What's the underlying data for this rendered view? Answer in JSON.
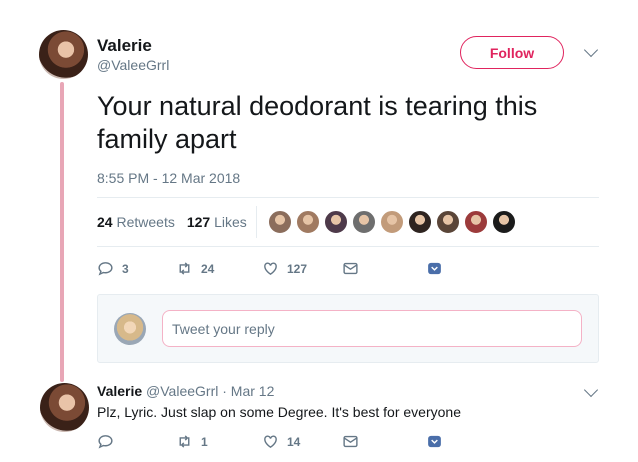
{
  "tweet": {
    "name": "Valerie",
    "handle": "@ValeeGrrl",
    "follow_label": "Follow",
    "text": "Your natural deodorant is tearing this family apart",
    "timestamp": "8:55 PM - 12 Mar 2018",
    "retweets_count": "24",
    "retweets_label": "Retweets",
    "likes_count": "127",
    "likes_label": "Likes",
    "actions": {
      "reply": "3",
      "retweet": "24",
      "like": "127"
    }
  },
  "likers": {
    "colors": [
      "#8b6d5c",
      "#a07a61",
      "#4e3a4a",
      "#6e6e6e",
      "#c29b7a",
      "#2e2420",
      "#5a4538",
      "#9c3b3b",
      "#1b1b1b"
    ]
  },
  "reply_box": {
    "placeholder": "Tweet your reply"
  },
  "reply": {
    "name": "Valerie",
    "handle": "@ValeeGrrl",
    "date": "· Mar 12",
    "text": "Plz, Lyric. Just slap on some Degree. It's best for everyone",
    "actions": {
      "reply": "",
      "retweet": "1",
      "like": "14"
    }
  },
  "colors": {
    "accent": "#e0245e",
    "thread": "#e8a6b6",
    "muted": "#657786"
  }
}
